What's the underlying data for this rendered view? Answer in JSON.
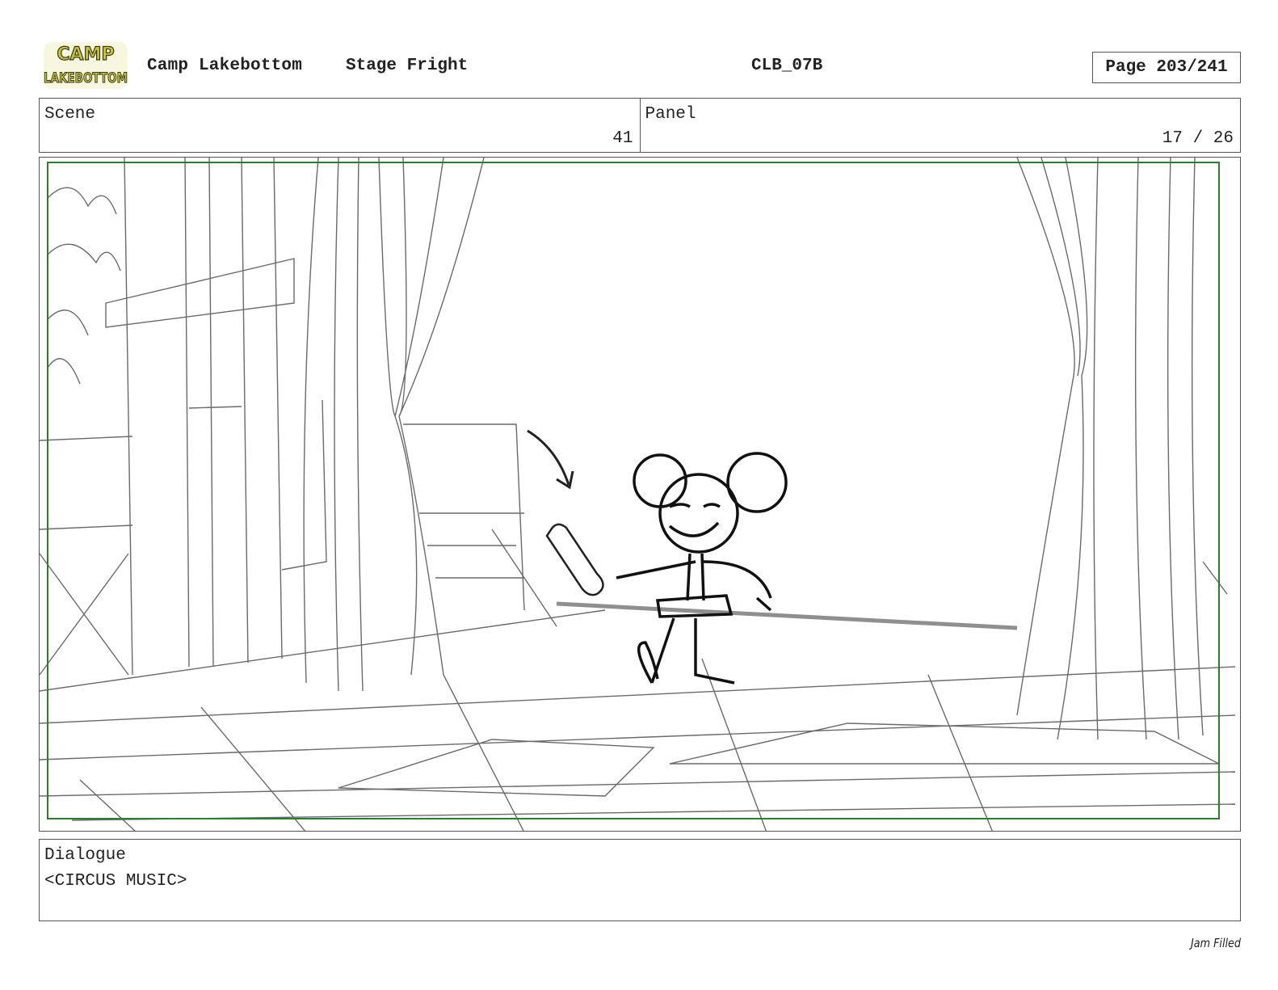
{
  "header": {
    "logo_text_line1": "CAMP",
    "logo_text_line2": "LAKEBOTTOM",
    "show_title": "Camp Lakebottom",
    "episode_title": "Stage Fright",
    "episode_code": "CLB_07B",
    "page_label": "Page 203/241"
  },
  "info": {
    "scene_label": "Scene",
    "scene_value": "41",
    "panel_label": "Panel",
    "panel_value": "17 / 26"
  },
  "dialogue": {
    "label": "Dialogue",
    "text": "<CIRCUS MUSIC>"
  },
  "footer": {
    "studio_logo_text": "Jam Filled"
  },
  "colors": {
    "safe_frame": "#2e7d2e",
    "logo_fill": "#c9c43a",
    "logo_outline": "#3a3a1a"
  }
}
